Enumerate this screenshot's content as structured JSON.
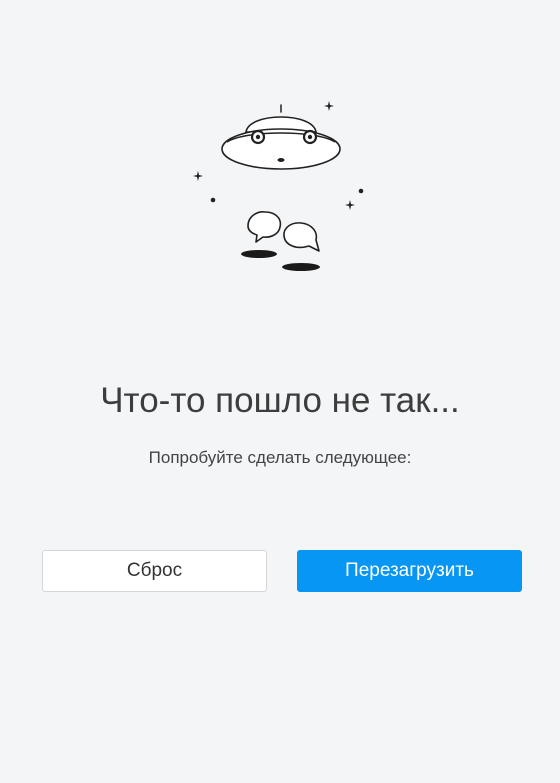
{
  "error": {
    "title": "Что-то пошло не так...",
    "subtitle": "Попробуйте сделать следующее:"
  },
  "actions": {
    "reset_label": "Сброс",
    "reload_label": "Перезагрузить"
  },
  "illustration": {
    "icon": "ufo-icon"
  },
  "colors": {
    "background": "#f4f5f7",
    "primary": "#0896f4",
    "text": "#3d3d3d"
  }
}
